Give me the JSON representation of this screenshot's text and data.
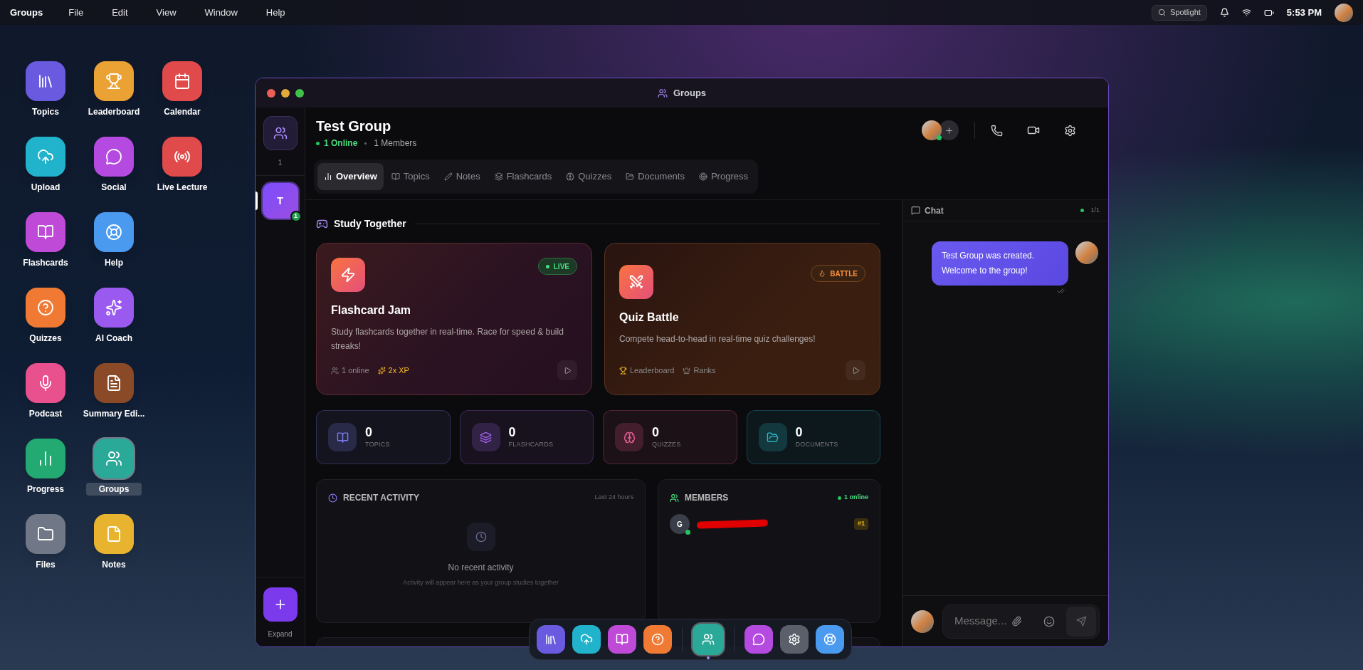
{
  "menubar": {
    "app": "Groups",
    "menus": [
      "File",
      "Edit",
      "View",
      "Window",
      "Help"
    ],
    "spotlight": "Spotlight",
    "time": "5:53 PM"
  },
  "desktop_rows": [
    [
      {
        "label": "Topics",
        "color": "#6a5ae0",
        "selected": false
      },
      {
        "label": "Leaderboard",
        "color": "#eba234",
        "selected": false
      },
      {
        "label": "Calendar",
        "color": "#e04a4a",
        "selected": false
      }
    ],
    [
      {
        "label": "Upload",
        "color": "#22b3cc",
        "selected": false
      },
      {
        "label": "Social",
        "color": "#b44ae0",
        "selected": false
      },
      {
        "label": "Live Lecture",
        "color": "#e04a4a",
        "selected": false
      }
    ],
    [
      {
        "label": "Flashcards",
        "color": "#c04ad8",
        "selected": false
      },
      {
        "label": "Help",
        "color": "#4a9af0",
        "selected": false
      }
    ],
    [
      {
        "label": "Quizzes",
        "color": "#f07a34",
        "selected": false
      },
      {
        "label": "AI Coach",
        "color": "#9a5af0",
        "selected": false
      }
    ],
    [
      {
        "label": "Podcast",
        "color": "#e8508e",
        "selected": false
      },
      {
        "label": "Summary Edi...",
        "color": "#8a4a28",
        "selected": false
      }
    ],
    [
      {
        "label": "Progress",
        "color": "#22aa72",
        "selected": false
      },
      {
        "label": "Groups",
        "color": "#2aa898",
        "selected": true
      }
    ],
    [
      {
        "label": "Files",
        "color": "#707888",
        "selected": false
      },
      {
        "label": "Notes",
        "color": "#e8b430",
        "selected": false
      }
    ]
  ],
  "window": {
    "title": "Groups"
  },
  "rail": {
    "count": "1",
    "groups": [
      {
        "initial": "T",
        "badge": "1",
        "selected": true
      }
    ],
    "expand": "Expand"
  },
  "group": {
    "name": "Test Group",
    "online": "1 Online",
    "members": "1 Members"
  },
  "tabs": [
    {
      "label": "Overview",
      "selected": true
    },
    {
      "label": "Topics",
      "selected": false
    },
    {
      "label": "Notes",
      "selected": false
    },
    {
      "label": "Flashcards",
      "selected": false
    },
    {
      "label": "Quizzes",
      "selected": false
    },
    {
      "label": "Documents",
      "selected": false
    },
    {
      "label": "Progress",
      "selected": false
    }
  ],
  "study_together": {
    "title": "Study Together",
    "cards": [
      {
        "title": "Flashcard Jam",
        "description": "Study flashcards together in real-time. Race for speed & build streaks!",
        "badge": "LIVE",
        "kind": "live",
        "meta": [
          {
            "text": "1 online",
            "highlight": false
          },
          {
            "text": "2x XP",
            "highlight": true
          }
        ]
      },
      {
        "title": "Quiz Battle",
        "description": "Compete head-to-head in real-time quiz challenges!",
        "badge": "BATTLE",
        "kind": "battle",
        "meta": [
          {
            "text": "Leaderboard",
            "highlight": false
          },
          {
            "text": "Ranks",
            "highlight": false
          }
        ]
      }
    ]
  },
  "stats": [
    {
      "value": "0",
      "label": "TOPICS",
      "color": "#7c7cf0"
    },
    {
      "value": "0",
      "label": "FLASHCARDS",
      "color": "#a064e8"
    },
    {
      "value": "0",
      "label": "QUIZZES",
      "color": "#e05c8c"
    },
    {
      "value": "0",
      "label": "DOCUMENTS",
      "color": "#2cb8c8"
    }
  ],
  "recent_activity": {
    "title": "RECENT ACTIVITY",
    "range": "Last 24 hours",
    "empty_title": "No recent activity",
    "empty_text": "Activity will appear here as your group studies together"
  },
  "members": {
    "title": "MEMBERS",
    "online": "1 online",
    "list": [
      {
        "initial": "G",
        "rank": "#1",
        "online": true
      }
    ]
  },
  "chat": {
    "title": "Chat",
    "count": "1/1",
    "messages": [
      {
        "text": "Test Group was created. Welcome to the group!"
      }
    ],
    "placeholder": "Message..."
  },
  "dock": [
    [
      {
        "color": "#6a5ae0",
        "selected": false
      },
      {
        "color": "#22b3cc",
        "selected": false
      },
      {
        "color": "#c04ad8",
        "selected": false
      },
      {
        "color": "#f07a34",
        "selected": false
      }
    ],
    [
      {
        "color": "#2aa898",
        "selected": true
      }
    ],
    [
      {
        "color": "#b44ae0",
        "selected": false
      },
      {
        "color": "#5a5f6a",
        "selected": false
      },
      {
        "color": "#4a9af0",
        "selected": false
      }
    ]
  ]
}
